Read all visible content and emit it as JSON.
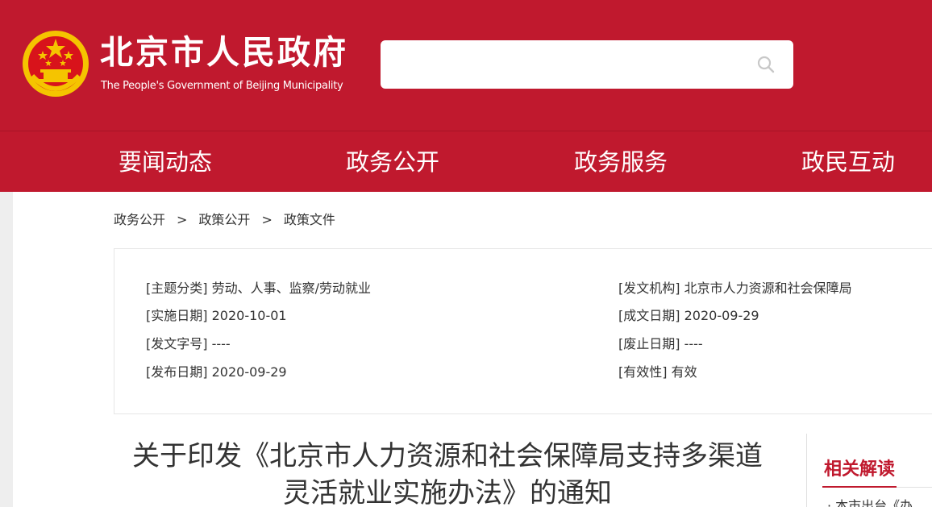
{
  "header": {
    "title": "北京市人民政府",
    "subtitle": "The People's Government of Beijing Municipality",
    "search": {
      "placeholder": "",
      "value": ""
    }
  },
  "nav": {
    "items": [
      "要闻动态",
      "政务公开",
      "政务服务",
      "政民互动"
    ]
  },
  "breadcrumb": {
    "items": [
      "政务公开",
      "政策公开",
      "政策文件"
    ],
    "separator": ">"
  },
  "meta": {
    "left": [
      {
        "label": "[主题分类]",
        "value": "劳动、人事、监察/劳动就业"
      },
      {
        "label": "[实施日期]",
        "value": "2020-10-01"
      },
      {
        "label": "[发文字号]",
        "value": "----"
      },
      {
        "label": "[发布日期]",
        "value": "2020-09-29"
      }
    ],
    "right": [
      {
        "label": "[发文机构]",
        "value": "北京市人力资源和社会保障局"
      },
      {
        "label": "[成文日期]",
        "value": "2020-09-29"
      },
      {
        "label": "[废止日期]",
        "value": "----"
      },
      {
        "label": "[有效性]",
        "value": "有效"
      }
    ]
  },
  "document": {
    "title": "关于印发《北京市人力资源和社会保障局支持多渠道灵活就业实施办法》的通知"
  },
  "sidebar": {
    "related_title": "相关解读",
    "first_item": "· 本市出台《办"
  },
  "colors": {
    "brand_red": "#c0192e",
    "emblem_gold": "#f5c400",
    "text": "#333333"
  }
}
